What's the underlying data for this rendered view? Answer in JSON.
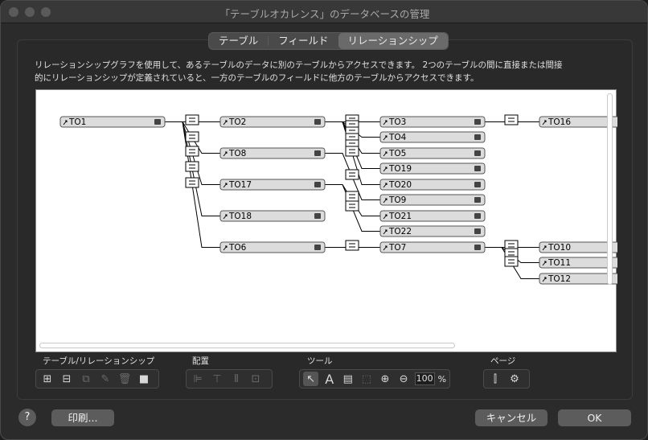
{
  "window": {
    "title": "「テーブルオカレンス」のデータベースの管理"
  },
  "tabs": [
    {
      "label": "テーブル",
      "active": false
    },
    {
      "label": "フィールド",
      "active": false
    },
    {
      "label": "リレーションシップ",
      "active": true
    }
  ],
  "description": {
    "line1": "リレーションシップグラフを使用して、あるテーブルのデータに別のテーブルからアクセスできます。 2つのテーブルの間に直接または間接",
    "line2": "的にリレーションシップが定義されていると、一方のテーブルのフィールドに他方のテーブルからアクセスできます。"
  },
  "graph": {
    "tables": [
      "TO1",
      "TO2",
      "TO8",
      "TO17",
      "TO18",
      "TO6",
      "TO3",
      "TO4",
      "TO5",
      "TO19",
      "TO20",
      "TO9",
      "TO21",
      "TO22",
      "TO7",
      "TO16",
      "TO10",
      "TO11",
      "TO12"
    ]
  },
  "toolbar": {
    "groups": [
      {
        "label": "テーブル/リレーションシップ",
        "icons": [
          "add-table-icon",
          "add-relationship-icon",
          "duplicate-icon",
          "edit-icon",
          "delete-icon",
          "note-icon"
        ]
      },
      {
        "label": "配置",
        "icons": [
          "align-left-icon",
          "align-top-icon",
          "distribute-icon",
          "resize-icon"
        ]
      },
      {
        "label": "ツール",
        "icons": [
          "pointer-icon",
          "text-tool-icon",
          "show-fields-icon",
          "select-related-icon",
          "zoom-in-icon",
          "zoom-out-icon"
        ]
      },
      {
        "label": "ページ",
        "icons": [
          "page-breaks-icon",
          "page-setup-icon"
        ]
      }
    ],
    "zoom_value": "100",
    "zoom_unit": "%"
  },
  "buttons": {
    "help": "?",
    "print": "印刷...",
    "cancel": "キャンセル",
    "ok": "OK"
  },
  "colors": {
    "window_bg": "#2b2b2b",
    "graph_bg": "#ffffff",
    "table_header": "#dcdcdc"
  }
}
